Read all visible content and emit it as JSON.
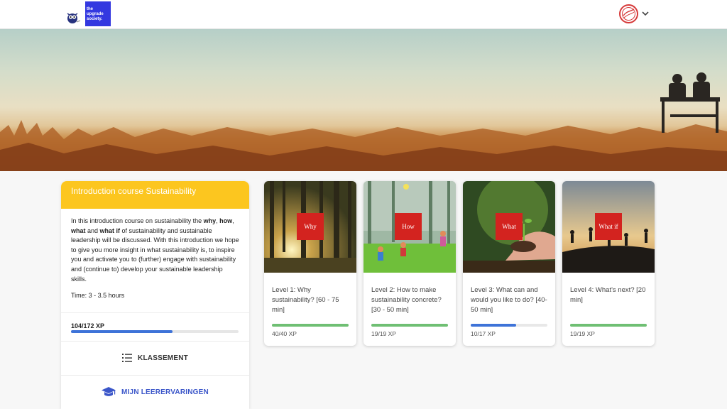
{
  "brand": {
    "name": "the upgrade society."
  },
  "course": {
    "title": "Introduction course Sustainability",
    "description_parts": [
      "In this introduction course on sustainability the ",
      "why",
      ", ",
      "how",
      ", ",
      "what",
      " and ",
      "what if",
      " of sustainability and sustainable leadership will be discussed. With this introduction we hope to give you more insight in what sustainability is, to inspire you and activate you to (further) engage with sustainability and (continue to) develop your sustainable leadership skills."
    ],
    "time": "Time: 3 - 3.5 hours",
    "xp_text": "104/172 XP",
    "xp_progress": 0.605,
    "leaderboard_label": "KLASSEMENT",
    "experiences_label": "MIJN LEERERVARINGEN"
  },
  "levels": [
    {
      "tag": "Why",
      "title": "Level 1: Why sustainability? [60 - 75 min]",
      "xp": "40/40 XP",
      "progress": 1.0,
      "bar_color": "#6fbf73"
    },
    {
      "tag": "How",
      "title": "Level 2: How to make sustainability concrete? [30 - 50 min]",
      "xp": "19/19 XP",
      "progress": 1.0,
      "bar_color": "#6fbf73"
    },
    {
      "tag": "What",
      "title": "Level 3: What can and would you like to do? [40-50 min]",
      "xp": "10/17 XP",
      "progress": 0.59,
      "bar_color": "#3e73d8"
    },
    {
      "tag": "What if",
      "title": "Level 4: What's next? [20 min]",
      "xp": "19/19 XP",
      "progress": 1.0,
      "bar_color": "#6fbf73"
    }
  ],
  "icons": {
    "mascot": "owl-mascot-icon",
    "avatar": "user-avatar-icon",
    "dropdown": "chevron-down-icon",
    "leaderboard": "list-ordered-icon",
    "experiences": "graduation-cap-icon"
  },
  "colors": {
    "accent_yellow": "#fcc61f",
    "brand_blue": "#3338e0",
    "tag_red": "#d3231f",
    "progress_blue": "#3e73d8",
    "progress_green": "#6fbf73"
  }
}
